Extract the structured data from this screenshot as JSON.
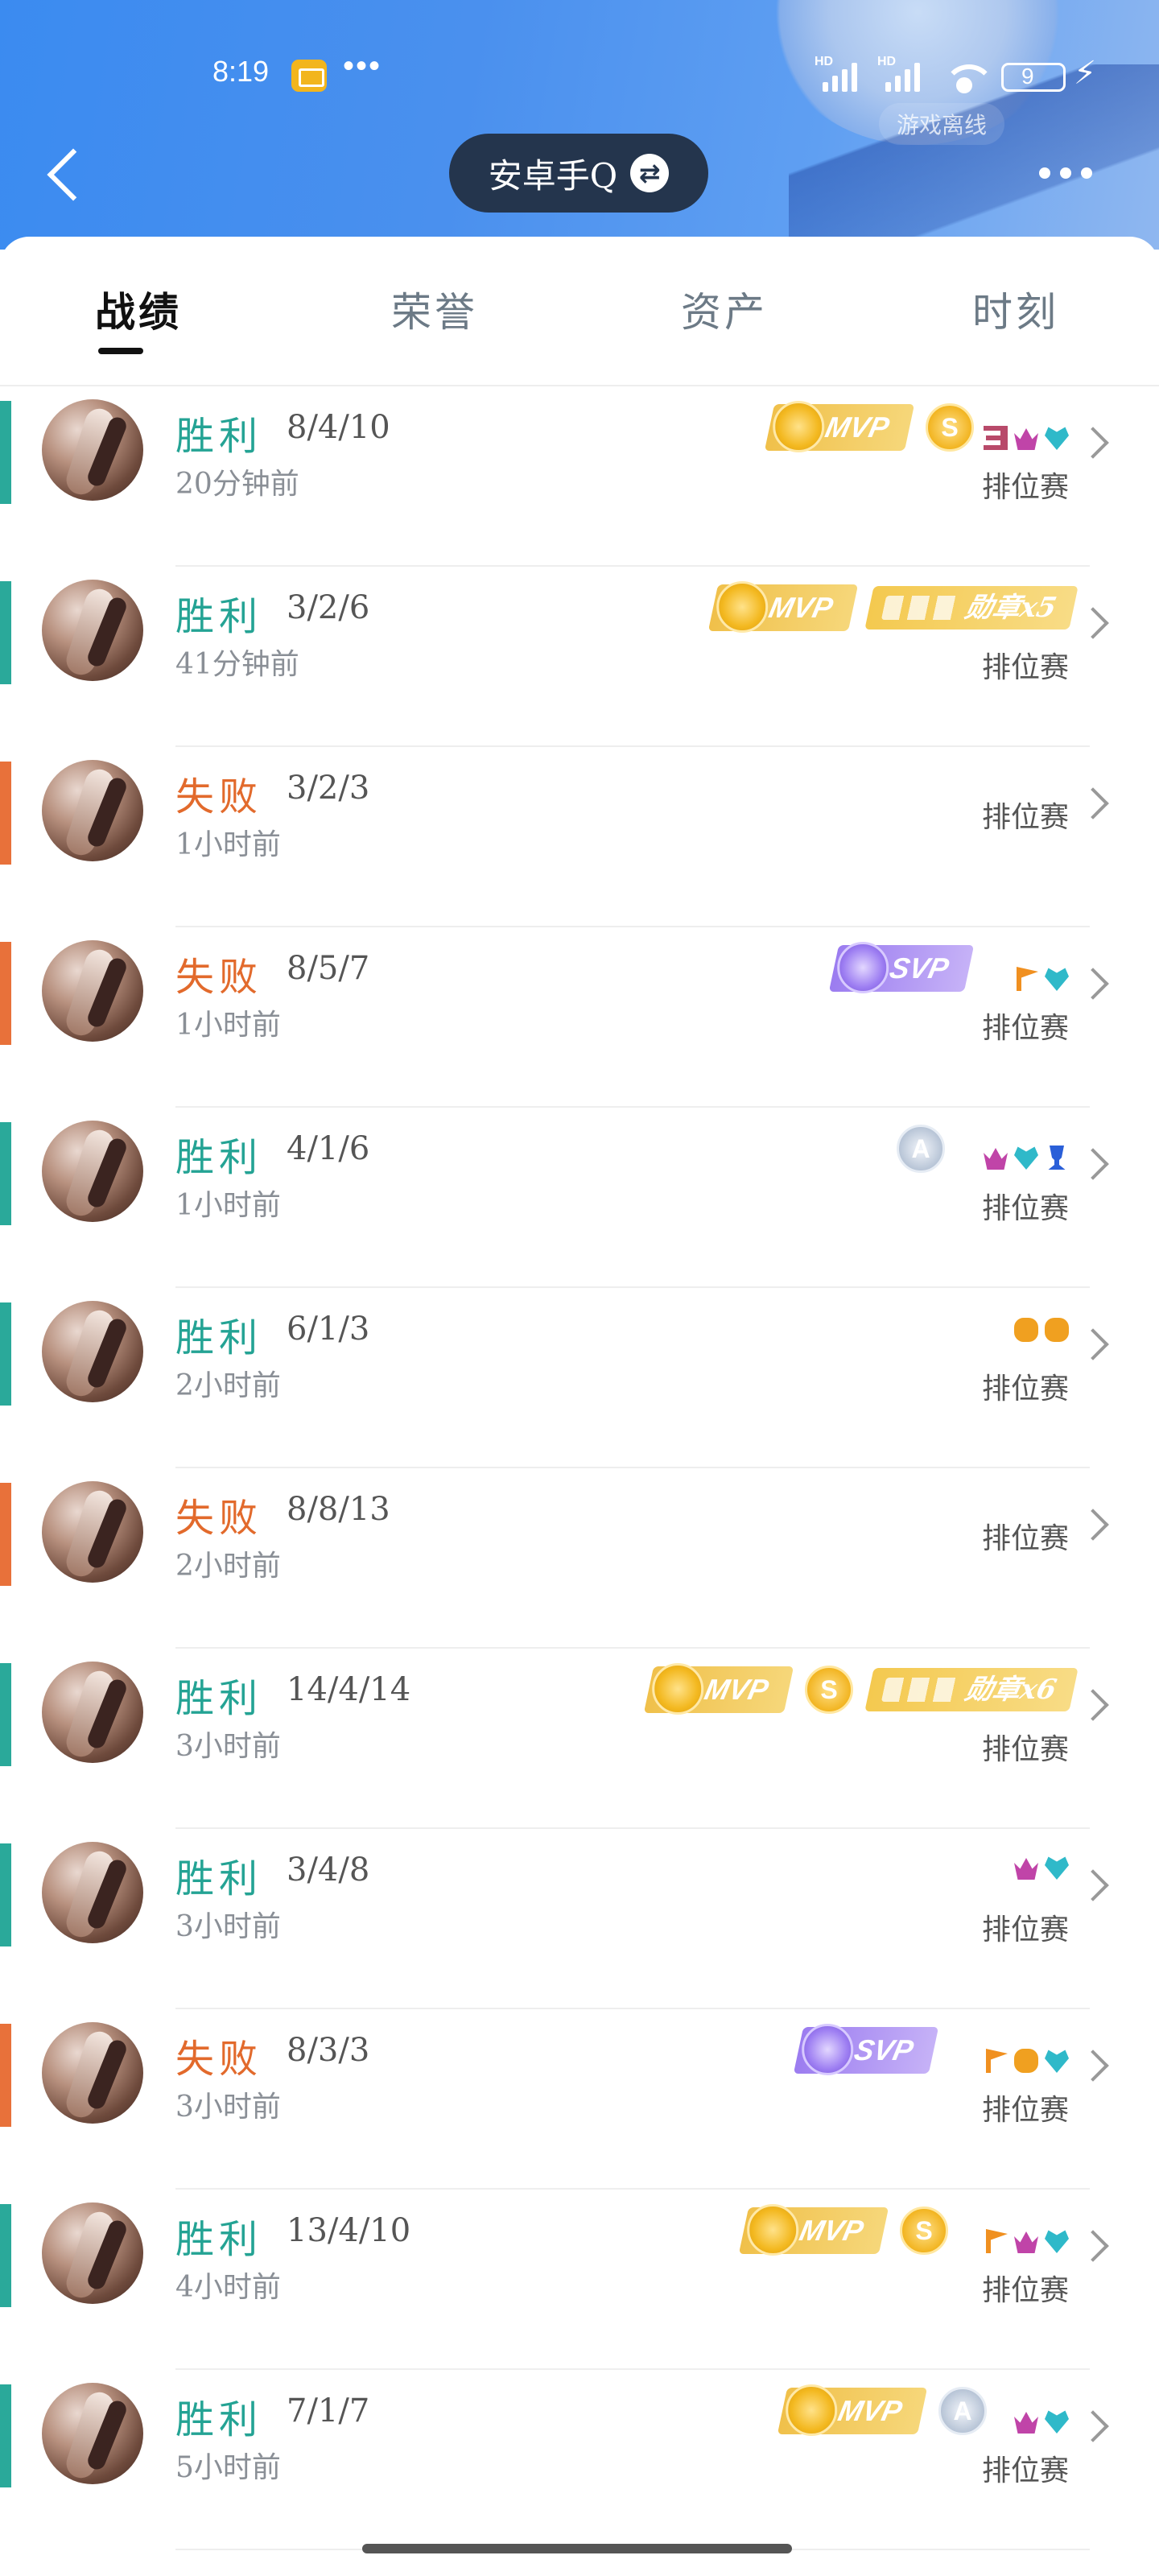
{
  "status": {
    "time": "8:19",
    "dots": "•••",
    "battery": "9",
    "offline_label": "游戏离线"
  },
  "header": {
    "account": "安卓手Q"
  },
  "tabs": [
    "战绩",
    "荣誉",
    "资产",
    "时刻"
  ],
  "matches": [
    {
      "result": "胜利",
      "kda": "8/4/10",
      "time": "20分钟前",
      "mode": "排位赛"
    },
    {
      "result": "胜利",
      "kda": "3/2/6",
      "time": "41分钟前",
      "mode": "排位赛",
      "medal": "勋章x5"
    },
    {
      "result": "失败",
      "kda": "3/2/3",
      "time": "1小时前",
      "mode": "排位赛"
    },
    {
      "result": "失败",
      "kda": "8/5/7",
      "time": "1小时前",
      "mode": "排位赛"
    },
    {
      "result": "胜利",
      "kda": "4/1/6",
      "time": "1小时前",
      "mode": "排位赛"
    },
    {
      "result": "胜利",
      "kda": "6/1/3",
      "time": "2小时前",
      "mode": "排位赛"
    },
    {
      "result": "失败",
      "kda": "8/8/13",
      "time": "2小时前",
      "mode": "排位赛"
    },
    {
      "result": "胜利",
      "kda": "14/4/14",
      "time": "3小时前",
      "mode": "排位赛",
      "medal": "勋章x6"
    },
    {
      "result": "胜利",
      "kda": "3/4/8",
      "time": "3小时前",
      "mode": "排位赛"
    },
    {
      "result": "失败",
      "kda": "8/3/3",
      "time": "3小时前",
      "mode": "排位赛"
    },
    {
      "result": "胜利",
      "kda": "13/4/10",
      "time": "4小时前",
      "mode": "排位赛"
    },
    {
      "result": "胜利",
      "kda": "7/1/7",
      "time": "5小时前",
      "mode": "排位赛"
    }
  ],
  "badge_labels": {
    "mvp": "MVP",
    "svp": "SVP",
    "s": "S",
    "a": "A"
  },
  "colors": {
    "win": "#2aa99a",
    "loss": "#e8713a",
    "header_pill": "#24354d",
    "accent": "#3b8bf0"
  }
}
